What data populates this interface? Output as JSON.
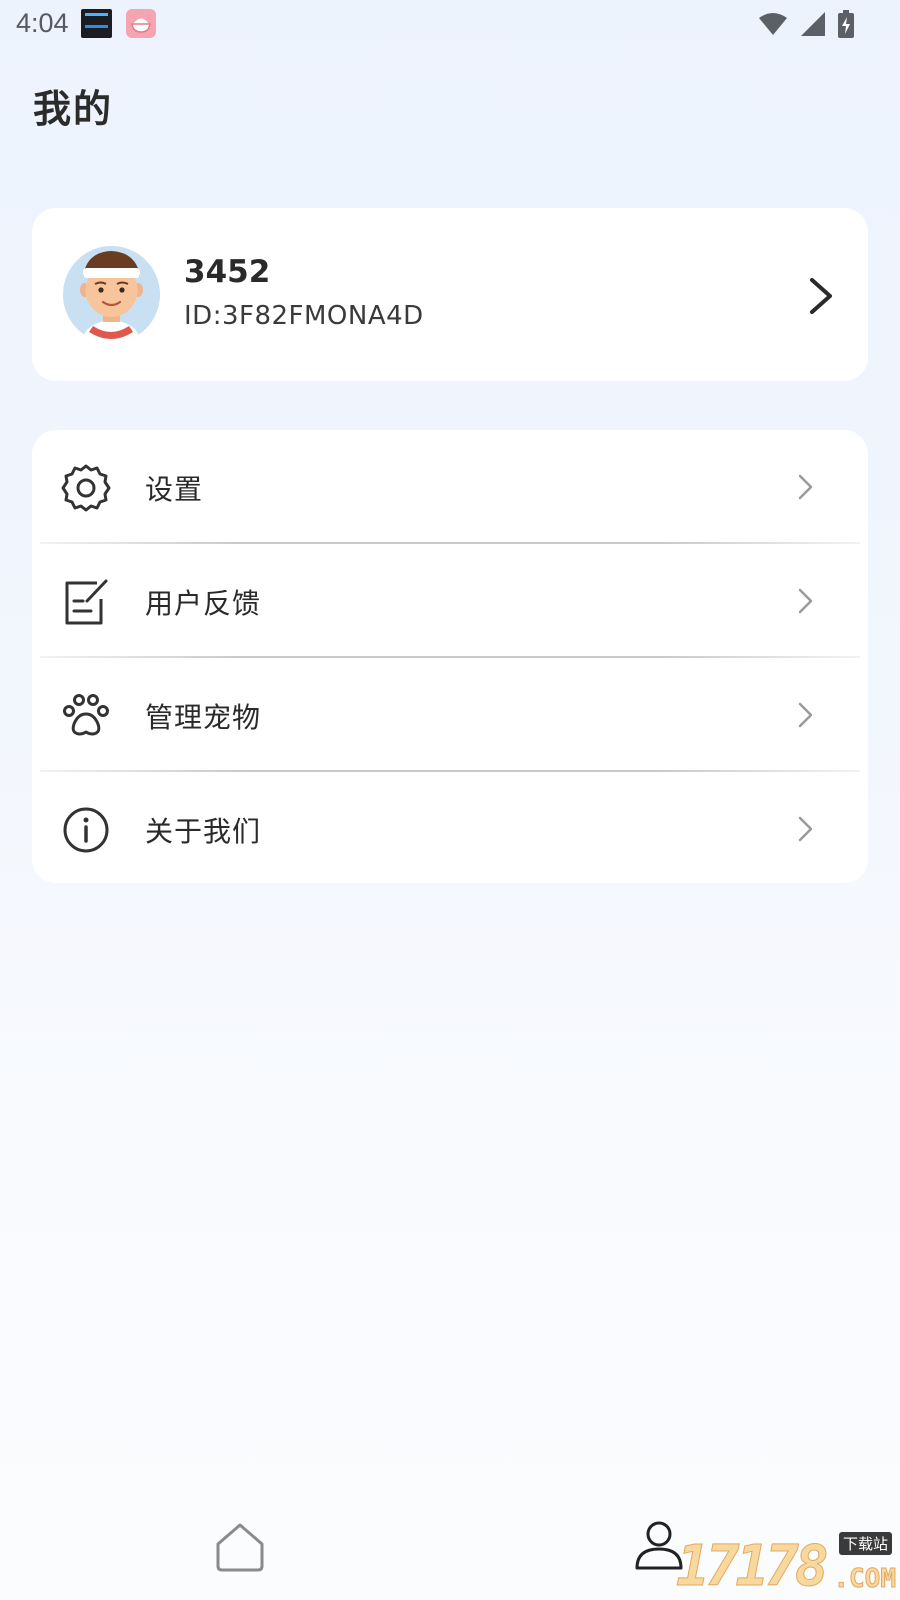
{
  "status_bar": {
    "time": "4:04",
    "icons": [
      "clock-widget-app-icon",
      "rice-bowl-app-icon",
      "wifi-icon",
      "cellular-signal-icon",
      "battery-charging-icon"
    ]
  },
  "page": {
    "title": "我的"
  },
  "profile": {
    "name": "3452",
    "id_text": "ID:3F82FMONA4D"
  },
  "menu": {
    "items": [
      {
        "label": "设置",
        "icon": "gear-icon"
      },
      {
        "label": "用户反馈",
        "icon": "feedback-edit-icon"
      },
      {
        "label": "管理宠物",
        "icon": "paw-icon"
      },
      {
        "label": "关于我们",
        "icon": "info-icon"
      }
    ]
  },
  "bottom_nav": {
    "items": [
      {
        "icon": "home-icon",
        "active": false
      },
      {
        "icon": "person-icon",
        "active": true
      }
    ]
  },
  "watermark": {
    "text": "17178",
    "badge": "下载站",
    "suffix": ".COM"
  },
  "colors": {
    "background_top": "#edf3fd",
    "background_bottom": "#fbfcfe",
    "card": "#ffffff",
    "text_primary": "#2a2a2a",
    "chevron_muted": "#9a9a9a"
  }
}
